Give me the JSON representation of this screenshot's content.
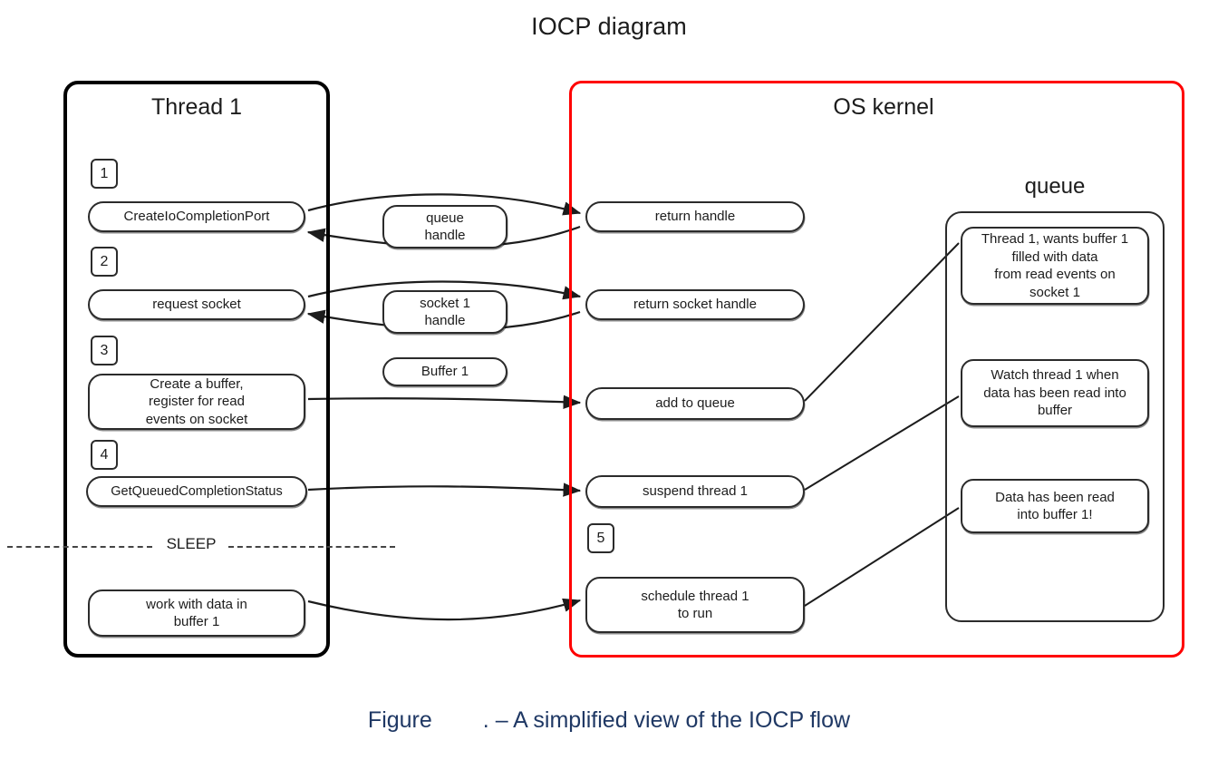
{
  "title": "IOCP diagram",
  "caption": {
    "prefix": "Figure",
    "suffix": ". – A simplified view of the IOCP flow",
    "color": "#1f3864"
  },
  "colors": {
    "thread_border": "#000000",
    "kernel_border": "#ff0000",
    "node_border": "#2b2b2b",
    "text": "#1c1c1c"
  },
  "thread_panel": {
    "heading": "Thread 1",
    "steps": [
      {
        "badge": "1",
        "label": "CreateIoCompletionPort"
      },
      {
        "badge": "2",
        "label": "request socket"
      },
      {
        "badge": "3",
        "label": "Create a buffer,\nregister for read\nevents on socket"
      },
      {
        "badge": "4",
        "label": "GetQueuedCompletionStatus"
      }
    ],
    "sleep_label": "SLEEP",
    "resume_node": "work with data in\nbuffer 1"
  },
  "middle_labels": [
    {
      "label": "queue\nhandle"
    },
    {
      "label": "socket 1\nhandle"
    },
    {
      "label": "Buffer 1"
    }
  ],
  "kernel_panel": {
    "heading": "OS kernel",
    "nodes": [
      {
        "label": "return handle"
      },
      {
        "label": "return socket handle"
      },
      {
        "label": "add to queue"
      },
      {
        "label": "suspend thread 1"
      },
      {
        "label": "schedule thread 1\nto run"
      }
    ],
    "step_badge": "5"
  },
  "queue_panel": {
    "heading": "queue",
    "items": [
      {
        "label": "Thread 1, wants buffer 1\nfilled with data\nfrom read events on\nsocket 1"
      },
      {
        "label": "Watch thread 1 when\ndata has been read into\nbuffer"
      },
      {
        "label": "Data has been read\ninto buffer 1!"
      }
    ]
  }
}
